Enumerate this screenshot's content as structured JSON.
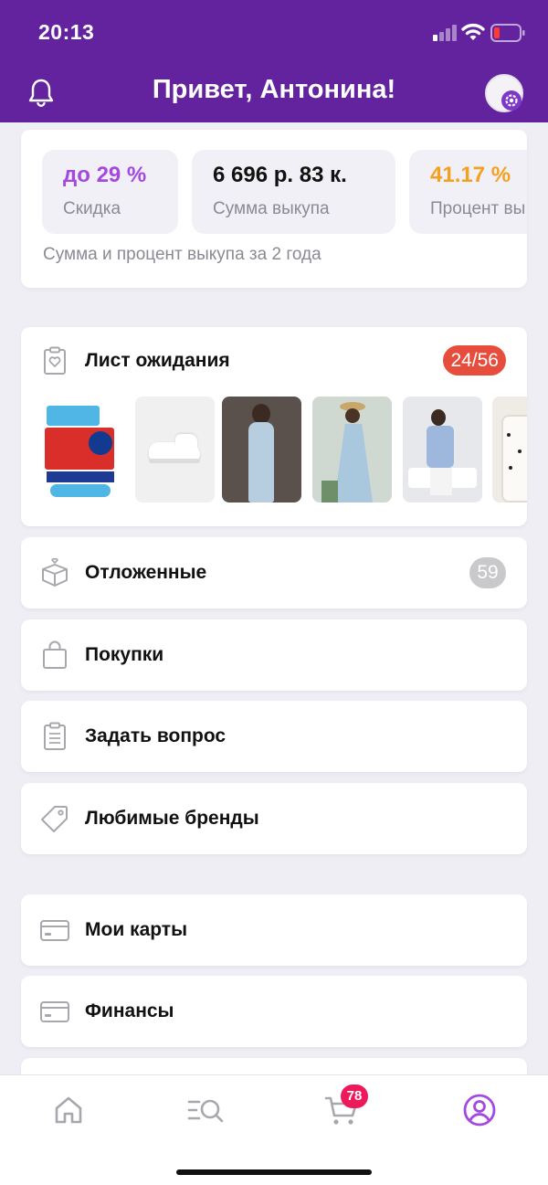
{
  "status_bar": {
    "time": "20:13"
  },
  "header": {
    "title": "Привет, Антонина!"
  },
  "stats": {
    "items": [
      {
        "value": "до 29 %",
        "label": "Скидка",
        "color": "#a349e0"
      },
      {
        "value": "6 696 р.  83 к.",
        "label": "Сумма выкупа",
        "color": "#111111"
      },
      {
        "value": "41.17 %",
        "label": "Процент вы",
        "color": "#f5a01f"
      }
    ],
    "note": "Сумма и процент выкупа за 2 года"
  },
  "waitlist": {
    "title": "Лист ожидания",
    "badge": "24/56"
  },
  "menu_group_1": [
    {
      "label": "Отложенные",
      "icon": "gift-box-icon",
      "badge": "59"
    },
    {
      "label": "Покупки",
      "icon": "shopping-bag-icon"
    },
    {
      "label": "Задать вопрос",
      "icon": "clipboard-icon"
    },
    {
      "label": "Любимые бренды",
      "icon": "tag-icon"
    }
  ],
  "menu_group_2": [
    {
      "label": "Мои карты",
      "icon": "card-icon"
    },
    {
      "label": "Финансы",
      "icon": "card-icon"
    }
  ],
  "tabbar": {
    "cart_count": "78"
  },
  "colors": {
    "brand": "#63239f",
    "accent": "#a349e0",
    "badge_red": "#e64d3d",
    "cart_badge": "#ed1a5b"
  }
}
